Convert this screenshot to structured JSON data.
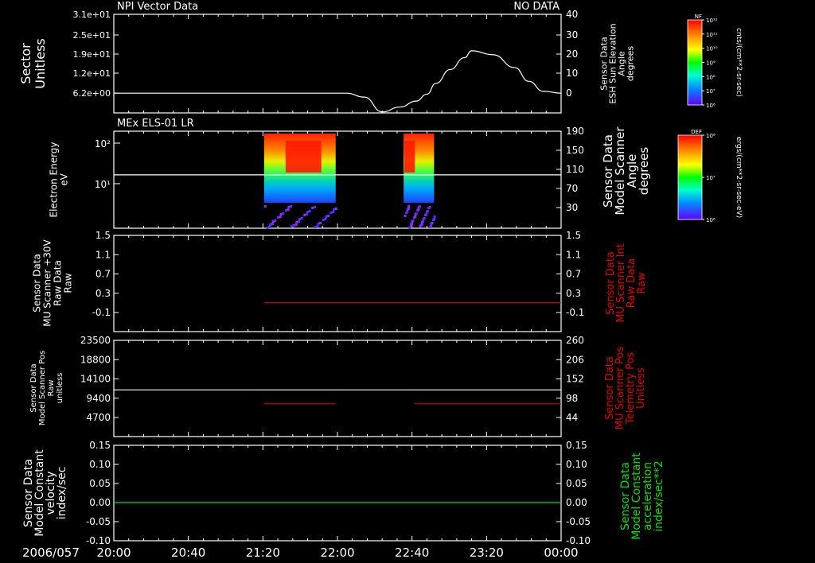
{
  "chart_data": [
    {
      "type": "line",
      "title": "NPI Vector Data",
      "status": "NO DATA",
      "ylabel": "Sector Unitless",
      "yticks": [
        "3.1e+01",
        "2.5e+01",
        "1.9e+01",
        "1.2e+01",
        "6.2e+00"
      ],
      "ylim": [
        0,
        31
      ],
      "right_ylabel": [
        "Sensor Data",
        "ESH Sun Elevation",
        "Angle",
        "degrees"
      ],
      "right_yticks": [
        "40",
        "30",
        "20",
        "10",
        "0"
      ],
      "right_ylim": [
        -10,
        40
      ],
      "series": [
        {
          "axis": "right",
          "color": "#ffffff",
          "x": [
            0,
            0.58,
            0.65,
            0.7,
            0.75,
            0.8,
            0.845,
            0.875,
            0.9,
            0.94,
            0.98,
            1.0,
            1.06,
            1.12,
            1.16,
            1.2,
            1.25
          ],
          "y": [
            0,
            0,
            0,
            -2,
            -9.5,
            -7,
            -4,
            -0.5,
            5,
            12,
            18,
            21.5,
            19.5,
            13,
            6,
            1,
            0
          ]
        }
      ]
    },
    {
      "type": "heatmap",
      "title": "MEx ELS-01 LR",
      "ylabel": [
        "Electron Energy",
        "eV"
      ],
      "yticks": [
        "10²",
        "10¹"
      ],
      "right_ylabel": [
        "Sensor Data",
        "Model Scanner",
        "Angle",
        "degrees"
      ],
      "right_yticks": [
        "190",
        "150",
        "110",
        "70",
        "30"
      ],
      "right_ylim": [
        -10,
        190
      ],
      "blocks": [
        {
          "x_start": 0.42,
          "x_end": 0.62
        },
        {
          "x_start": 0.81,
          "x_end": 0.895
        }
      ],
      "series": [
        {
          "axis": "right",
          "color": "#ffffff",
          "x": [
            0,
            1.25
          ],
          "y": [
            100,
            100
          ]
        }
      ]
    },
    {
      "type": "line",
      "ylabel": [
        "Sensor Data",
        "MU Scanner +30V",
        "Raw Data",
        "Raw"
      ],
      "yticks": [
        "1.5",
        "1.1",
        "0.7",
        "0.3",
        "-0.1"
      ],
      "ylim": [
        -0.5,
        1.5
      ],
      "right_ylabel": [
        "Sensor Data",
        "MU Scanner Int",
        "Raw Data",
        "Raw"
      ],
      "right_yticks": [
        "1.5",
        "1.1",
        "0.7",
        "0.3",
        "-0.1"
      ],
      "series": [
        {
          "color": "#e00000",
          "x": [
            0.42,
            1.25
          ],
          "y": [
            0.1,
            0.1
          ]
        }
      ]
    },
    {
      "type": "line",
      "ylabel": [
        "Sensor Data",
        "Model Scanner Pos",
        "Raw",
        "unitless"
      ],
      "yticks": [
        "23500",
        "18800",
        "14100",
        "9400",
        "4700"
      ],
      "ylim": [
        0,
        23500
      ],
      "right_ylabel": [
        "Sensor Data",
        "MU Scanner Pos",
        "Telemetry Pos",
        "Unitless"
      ],
      "right_yticks": [
        "260",
        "206",
        "152",
        "98",
        "44"
      ],
      "right_ylim": [
        -10,
        260
      ],
      "series": [
        {
          "color": "#ffffff",
          "x": [
            0,
            1.25
          ],
          "y": [
            11400,
            11400
          ]
        },
        {
          "color": "#e00000",
          "x": [
            0.42,
            0.62
          ],
          "y": [
            8000,
            8000
          ]
        },
        {
          "color": "#e00000",
          "x": [
            0.84,
            1.25
          ],
          "y": [
            8000,
            8000
          ]
        }
      ]
    },
    {
      "type": "line",
      "ylabel": [
        "Sensor Data",
        "Model Constant",
        "velocity",
        "index/sec"
      ],
      "yticks": [
        "0.15",
        "0.10",
        "0.05",
        "0.00",
        "-0.05",
        "-0.10"
      ],
      "ylim": [
        -0.1,
        0.15
      ],
      "right_ylabel": [
        "Sensor Data",
        "Model Constant",
        "acceleration",
        "index/sec**2"
      ],
      "right_yticks": [
        "0.15",
        "0.10",
        "0.05",
        "0.00",
        "-0.05",
        "-0.10"
      ],
      "series": [
        {
          "color": "#00e000",
          "x": [
            0,
            1.25
          ],
          "y": [
            0,
            0
          ]
        }
      ]
    }
  ],
  "x_axis": {
    "date_label": "2006/057",
    "ticks": [
      "20:00",
      "20:40",
      "21:20",
      "22:00",
      "22:40",
      "23:20",
      "00:00"
    ]
  },
  "colorbars": [
    {
      "label": "NF",
      "ticks": [
        "10¹²",
        "10¹¹",
        "10¹⁰",
        "10⁹",
        "10⁸",
        "10⁷",
        "10⁶"
      ],
      "units": "cnts/(cm**2-sr-sec)"
    },
    {
      "label": "DEF",
      "ticks": [
        "10⁸",
        "10⁷",
        "10⁶"
      ],
      "units": "ergs/(cm**2-sr-sec-eV)"
    }
  ],
  "colors": {
    "red": "#e00000",
    "green": "#00e000",
    "white": "#ffffff"
  }
}
